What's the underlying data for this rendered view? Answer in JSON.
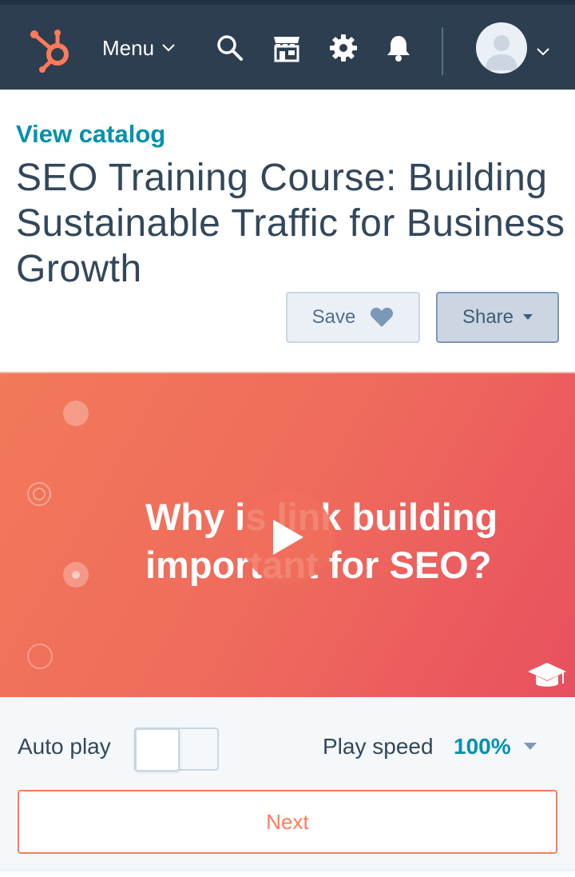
{
  "nav": {
    "menu_label": "Menu",
    "icons": [
      "sprocket-logo-icon",
      "search-icon",
      "marketplace-icon",
      "gear-icon",
      "bell-icon",
      "avatar-icon"
    ]
  },
  "header": {
    "view_catalog": "View catalog",
    "title": "SEO Training Course: Building Sustainable Traffic for Business Growth",
    "save_label": "Save",
    "share_label": "Share"
  },
  "video": {
    "overlay_text_line1": "Why is link building",
    "overlay_text_line2": "important for SEO?"
  },
  "controls": {
    "autoplay_label": "Auto play",
    "autoplay_on": false,
    "play_speed_label": "Play speed",
    "play_speed_value": "100%",
    "next_label": "Next"
  },
  "colors": {
    "nav_bg": "#2d3e50",
    "brand_orange": "#ff7a59",
    "link_teal": "#0091ae",
    "text_dark": "#33475b"
  }
}
